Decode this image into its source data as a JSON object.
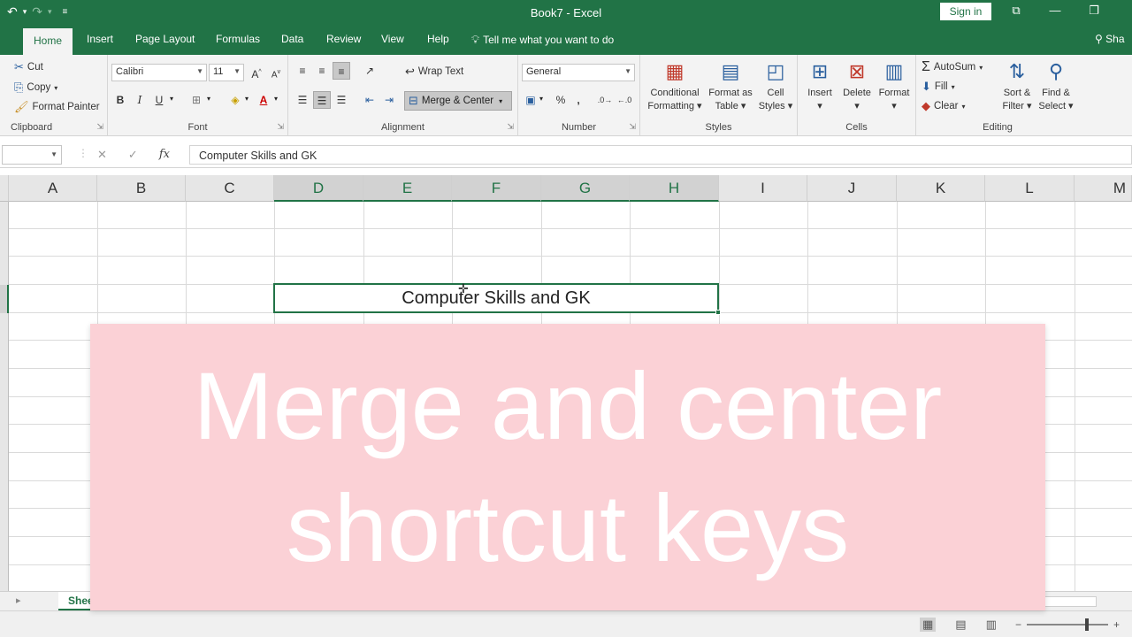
{
  "title_bar": {
    "document_title": "Book7  -  Excel",
    "signin_label": "Sign in",
    "quick_access": {
      "undo_icon": "↶",
      "redo_icon": "↷",
      "dropdown_icon": "▾",
      "customize_icon": "≡"
    },
    "window_buttons": {
      "ribbon_options_icon": "⧉",
      "minimize_icon": "—",
      "restore_icon": "❐"
    }
  },
  "tabs": {
    "items": [
      "Home",
      "Insert",
      "Page Layout",
      "Formulas",
      "Data",
      "Review",
      "View",
      "Help"
    ],
    "active": "Home",
    "tell_me": "Tell me what you want to do",
    "share": "Sha"
  },
  "ribbon": {
    "clipboard": {
      "label": "Clipboard",
      "cut": "Cut",
      "copy": "Copy",
      "format_painter": "Format Painter"
    },
    "font": {
      "label": "Font",
      "font_name": "Calibri",
      "font_size": "11",
      "bold": "B",
      "italic": "I",
      "underline": "U",
      "grow": "A",
      "shrink": "A",
      "font_color": "A"
    },
    "alignment": {
      "label": "Alignment",
      "wrap_text": "Wrap Text",
      "merge_center": "Merge & Center"
    },
    "number": {
      "label": "Number",
      "format": "General",
      "percent": "%",
      "comma": ","
    },
    "styles": {
      "label": "Styles",
      "conditional_formatting_1": "Conditional",
      "conditional_formatting_2": "Formatting",
      "format_as_table_1": "Format as",
      "format_as_table_2": "Table",
      "cell_styles_1": "Cell",
      "cell_styles_2": "Styles"
    },
    "cells": {
      "label": "Cells",
      "insert": "Insert",
      "delete": "Delete",
      "format": "Format"
    },
    "editing": {
      "label": "Editing",
      "autosum": "AutoSum",
      "fill": "Fill",
      "clear": "Clear",
      "sort_filter_1": "Sort &",
      "sort_filter_2": "Filter",
      "find_select_1": "Find &",
      "find_select_2": "Select"
    }
  },
  "formula_bar": {
    "name_box": "",
    "cancel_icon": "✕",
    "enter_icon": "✓",
    "fx_label": "fx",
    "formula": "Computer Skills and GK"
  },
  "grid": {
    "columns": [
      "A",
      "B",
      "C",
      "D",
      "E",
      "F",
      "G",
      "H",
      "I",
      "J",
      "K",
      "L",
      "M"
    ],
    "selected_columns": [
      "D",
      "E",
      "F",
      "G",
      "H"
    ],
    "merged_cell_text": "Computer Skills and GK"
  },
  "banner": {
    "line1": "Merge and center",
    "line2": "shortcut keys"
  },
  "sheet_tabs": {
    "active_sheet": "Shee"
  },
  "colors": {
    "excel_green": "#217346",
    "banner_pink": "#fbd1d6"
  }
}
